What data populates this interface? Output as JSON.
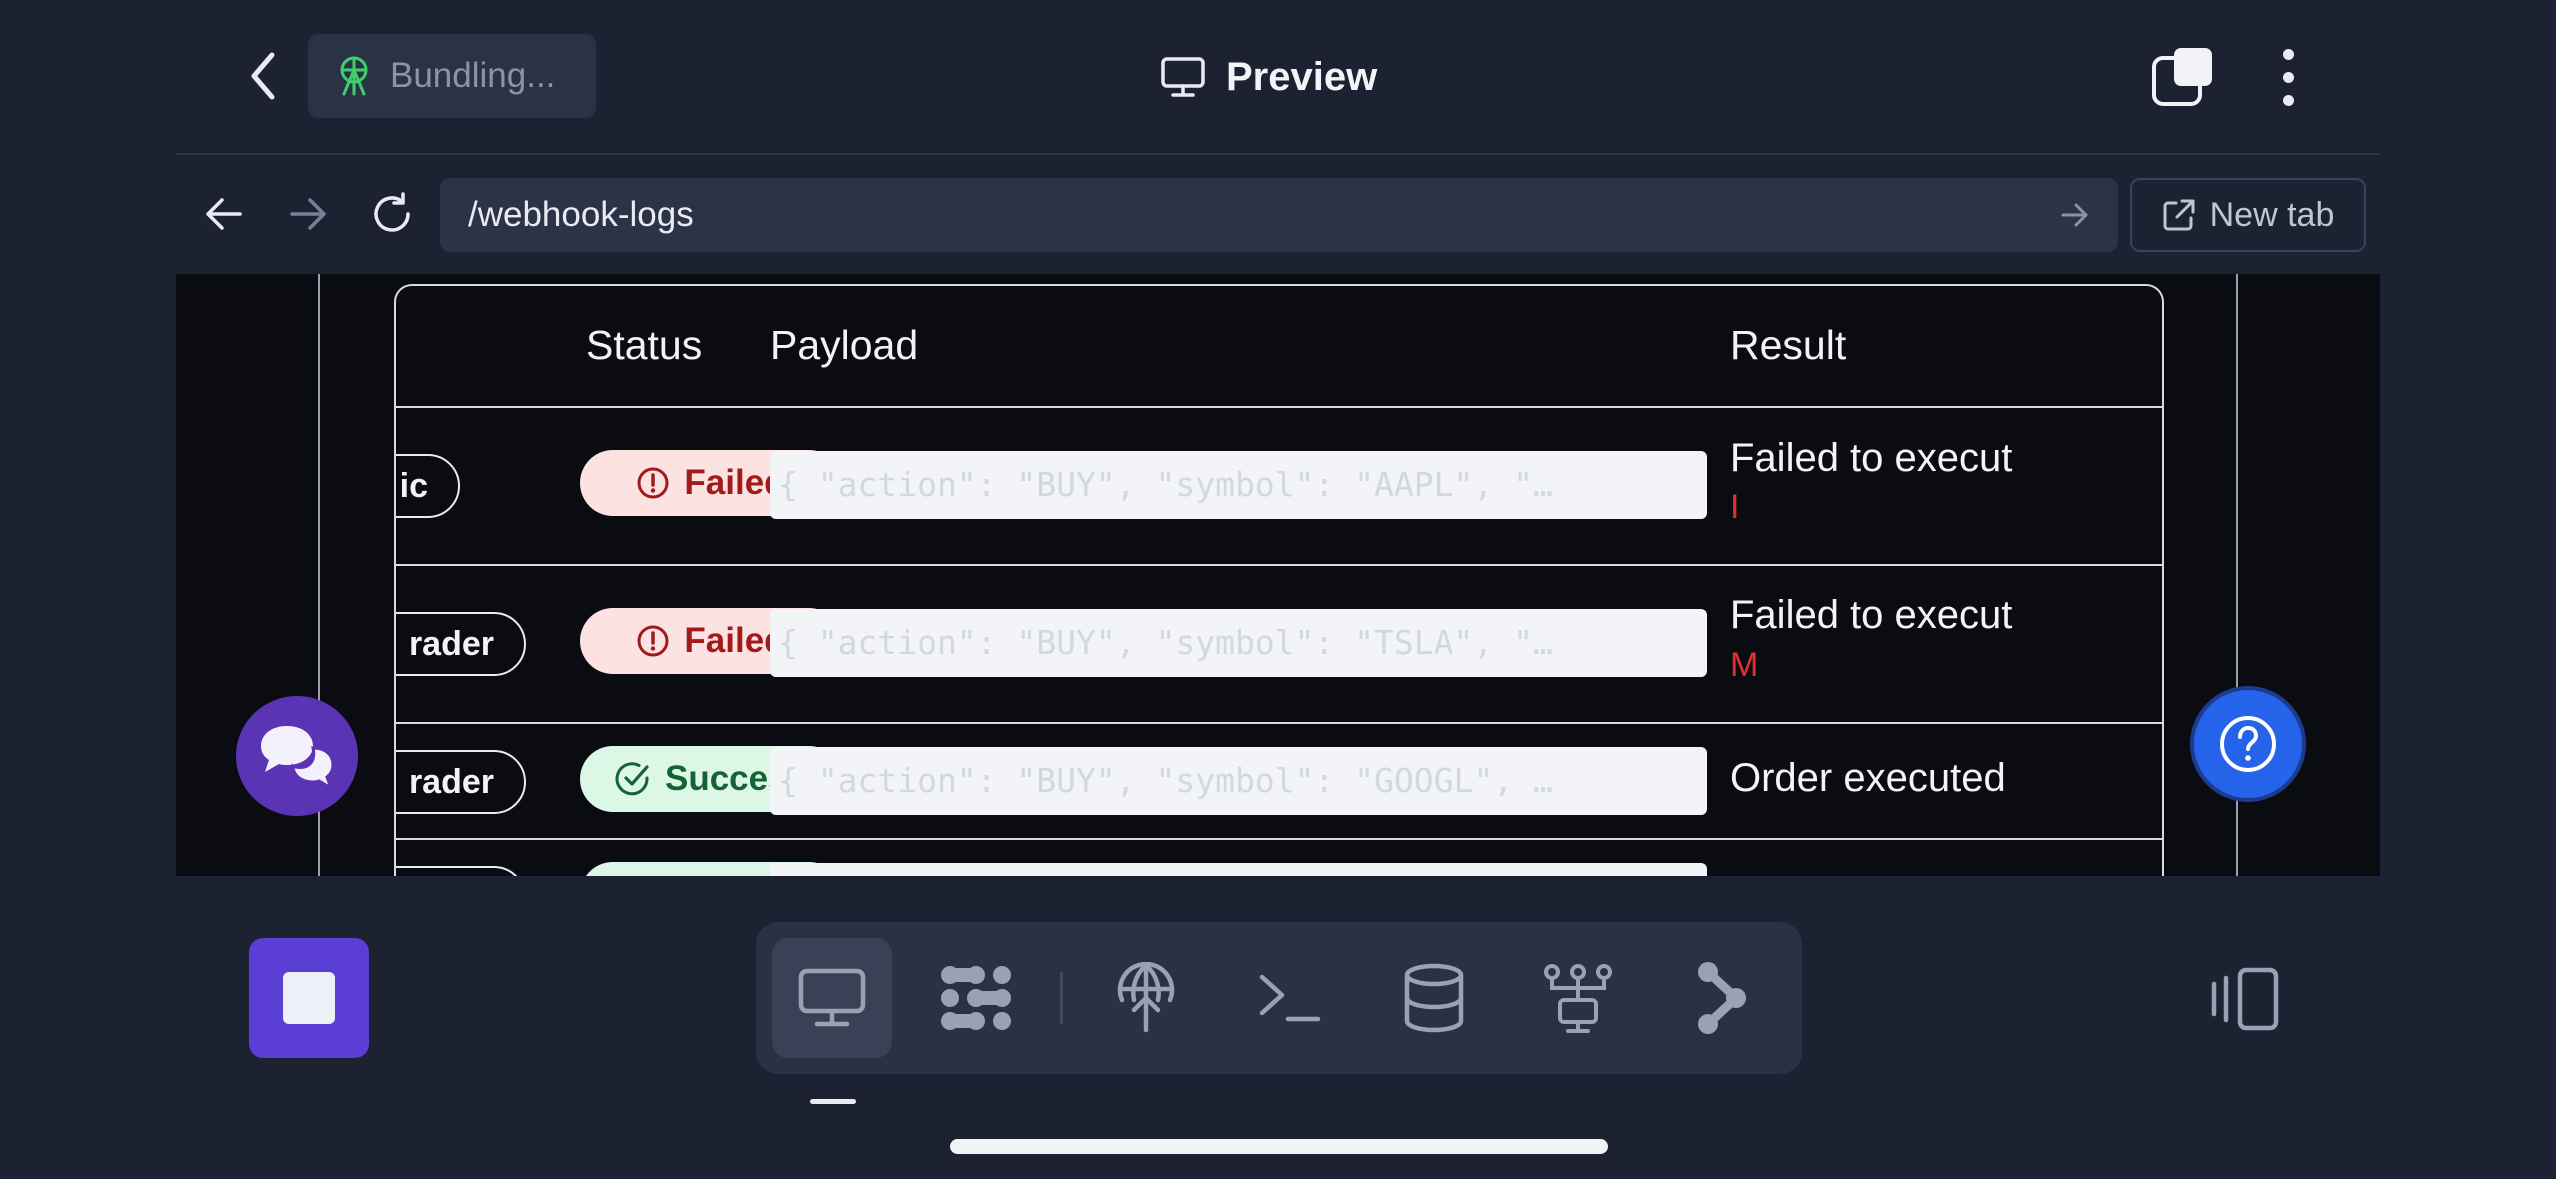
{
  "topbar": {
    "status_text": "Bundling...",
    "title": "Preview"
  },
  "urlbar": {
    "url": "/webhook-logs",
    "new_tab_label": "New tab"
  },
  "table": {
    "headers": {
      "status": "Status",
      "payload": "Payload",
      "result": "Result"
    },
    "rows": [
      {
        "tag": "ic",
        "status": "Failed",
        "status_type": "failed",
        "payload": "{ \"action\": \"BUY\", \"symbol\": \"AAPL\", \"…",
        "result": "Failed to execut",
        "result_sub": "I"
      },
      {
        "tag": "rader",
        "status": "Failed",
        "status_type": "failed",
        "payload": "{ \"action\": \"BUY\", \"symbol\": \"TSLA\", \"…",
        "result": "Failed to execut",
        "result_sub": "M"
      },
      {
        "tag": "rader",
        "status": "Success",
        "status_type": "success",
        "payload": "{ \"action\": \"BUY\", \"symbol\": \"GOOGL\", …",
        "result": "Order executed",
        "result_sub": ""
      }
    ]
  },
  "icons": {
    "status": "broadcast-tower-icon",
    "title": "monitor-icon",
    "chat_fab": "chat-bubbles-icon",
    "help_fab": "question-circle-icon"
  },
  "toolbar": {
    "items": [
      "preview",
      "apps",
      "deploy",
      "terminal",
      "database",
      "network",
      "integrations"
    ],
    "active": "preview"
  },
  "colors": {
    "background": "#1c2232",
    "accent_purple": "#5b3fd4",
    "help_blue": "#2563eb",
    "failed_bg": "#fde2e2",
    "success_bg": "#dcf7e5"
  }
}
